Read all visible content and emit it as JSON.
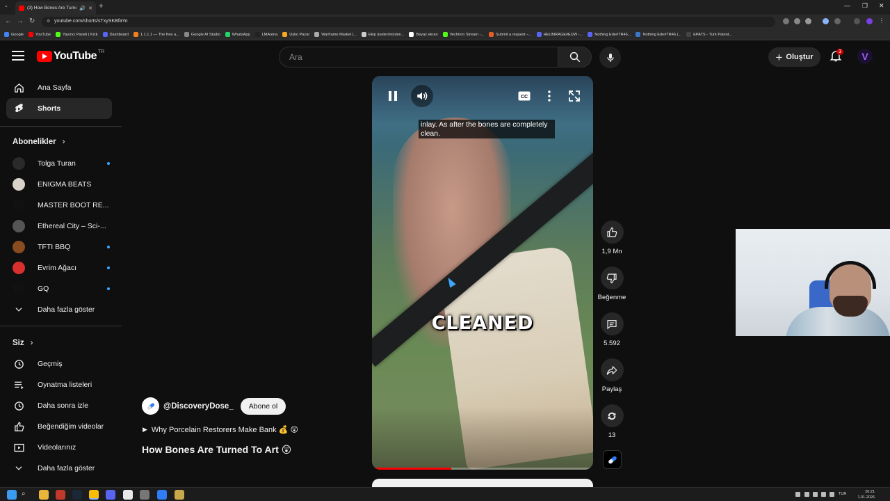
{
  "browser": {
    "tab_title": "(3) How Bones Are Turned",
    "url": "youtube.com/shorts/sTxySKBfaYo",
    "bookmarks": [
      {
        "label": "Google",
        "color": "#4285f4"
      },
      {
        "label": "YouTube",
        "color": "#ff0000"
      },
      {
        "label": "Yayıncı Paneli | Kick",
        "color": "#53fc18"
      },
      {
        "label": "Dashboard",
        "color": "#5865f2"
      },
      {
        "label": "1.1.1.1 — The free a...",
        "color": "#f38020"
      },
      {
        "label": "Google AI Studio",
        "color": "#888888"
      },
      {
        "label": "WhatsApp",
        "color": "#25d366"
      },
      {
        "label": "LMArena",
        "color": "#222222"
      },
      {
        "label": "Usko Pazar",
        "color": "#f5a623"
      },
      {
        "label": "Warframe Market |...",
        "color": "#aaaaaa"
      },
      {
        "label": "Ekip üyelerimizden...",
        "color": "#cccccc"
      },
      {
        "label": "Beyaz ekran",
        "color": "#ffffff"
      },
      {
        "label": "Vechiron Stream -...",
        "color": "#53fc18"
      },
      {
        "label": "Submit a request –...",
        "color": "#e35d27"
      },
      {
        "label": "HEUMRAGE#EUW -...",
        "color": "#5865f2"
      },
      {
        "label": "Nothing Ede#TR46...",
        "color": "#5865f2"
      },
      {
        "label": "Nothing Ede#TR46 (...",
        "color": "#3a78c9"
      },
      {
        "label": "EPATS - Türk Patent...",
        "color": "#444444"
      }
    ]
  },
  "masthead": {
    "logo_text": "YouTube",
    "country_code": "TR",
    "search_placeholder": "Ara",
    "create_label": "Oluştur",
    "notification_count": "3"
  },
  "sidebar": {
    "main": [
      {
        "label": "Ana Sayfa",
        "icon": "home-icon",
        "active": false
      },
      {
        "label": "Shorts",
        "icon": "shorts-icon",
        "active": true
      }
    ],
    "subscriptions_header": "Abonelikler",
    "subscriptions": [
      {
        "label": "Tolga Turan",
        "color": "#2a2a2a",
        "new": true
      },
      {
        "label": "ENIGMA BEATS",
        "color": "#d9d2c8",
        "new": false
      },
      {
        "label": "MASTER BOOT RE...",
        "color": "#111111",
        "new": false
      },
      {
        "label": "Ethereal City – Sci-...",
        "color": "#555555",
        "new": false
      },
      {
        "label": "TFTI BBQ",
        "color": "#8a4b1f",
        "new": true
      },
      {
        "label": "Evrim Ağacı",
        "color": "#d8302f",
        "new": true
      },
      {
        "label": "GQ",
        "color": "#111111",
        "new": true
      }
    ],
    "show_more": "Daha fazla göster",
    "you_header": "Siz",
    "you_items": [
      {
        "label": "Geçmiş",
        "icon": "history-icon"
      },
      {
        "label": "Oynatma listeleri",
        "icon": "playlists-icon"
      },
      {
        "label": "Daha sonra izle",
        "icon": "watch-later-icon"
      },
      {
        "label": "Beğendiğim videolar",
        "icon": "liked-videos-icon"
      },
      {
        "label": "Videolarınız",
        "icon": "your-videos-icon"
      }
    ],
    "you_show_more": "Daha fazla göster"
  },
  "short": {
    "caption": "inlay. As after the bones are completely clean.",
    "overlay_word": "CLEANED",
    "progress": 0.36,
    "channel": "@DiscoveryDose_",
    "subscribe_label": "Abone ol",
    "related_link": "Why Porcelain Restorers Make Bank 💰 😲",
    "title": "How Bones Are Turned To Art 😲"
  },
  "actions": {
    "like_count": "1,9 Mn",
    "dislike_label": "Beğenme",
    "comment_count": "5.592",
    "share_label": "Paylaş",
    "remix_count": "13"
  },
  "taskbar": {
    "language": "TUR",
    "time": "20:21",
    "date": "1.01.2026"
  }
}
